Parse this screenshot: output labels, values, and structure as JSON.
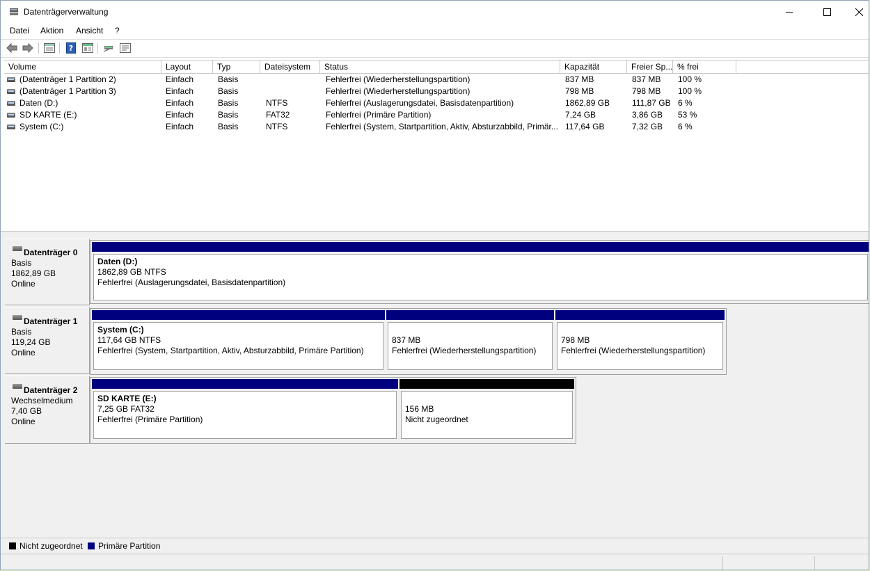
{
  "window": {
    "title": "Datenträgerverwaltung"
  },
  "menu": [
    "Datei",
    "Aktion",
    "Ansicht",
    "?"
  ],
  "toolbar": {
    "icons": [
      "back-arrow-icon",
      "forward-arrow-icon",
      "volume-view-icon",
      "help-icon",
      "properties-icon",
      "connect-disk-icon",
      "list-view-icon"
    ]
  },
  "volume_table": {
    "columns": [
      "Volume",
      "Layout",
      "Typ",
      "Dateisystem",
      "Status",
      "Kapazität",
      "Freier Sp...",
      "% frei"
    ],
    "rows": [
      [
        "(Datenträger 1 Partition 2)",
        "Einfach",
        "Basis",
        "",
        "Fehlerfrei (Wiederherstellungspartition)",
        "837 MB",
        "837 MB",
        "100 %"
      ],
      [
        "(Datenträger 1 Partition 3)",
        "Einfach",
        "Basis",
        "",
        "Fehlerfrei (Wiederherstellungspartition)",
        "798 MB",
        "798 MB",
        "100 %"
      ],
      [
        "Daten (D:)",
        "Einfach",
        "Basis",
        "NTFS",
        "Fehlerfrei (Auslagerungsdatei, Basisdatenpartition)",
        "1862,89 GB",
        "111,87 GB",
        "6 %"
      ],
      [
        "SD KARTE (E:)",
        "Einfach",
        "Basis",
        "FAT32",
        "Fehlerfrei (Primäre Partition)",
        "7,24 GB",
        "3,86 GB",
        "53 %"
      ],
      [
        "System (C:)",
        "Einfach",
        "Basis",
        "NTFS",
        "Fehlerfrei (System, Startpartition, Aktiv, Absturzabbild, Primär...",
        "117,64 GB",
        "7,32 GB",
        "6 %"
      ]
    ]
  },
  "disks": [
    {
      "name": "Datenträger 0",
      "type": "Basis",
      "size": "1862,89 GB",
      "state": "Online",
      "partitions": [
        {
          "name": "Daten  (D:)",
          "size": "1862,89 GB NTFS",
          "status": "Fehlerfrei (Auslagerungsdatei, Basisdatenpartition)",
          "kind": "primary"
        }
      ]
    },
    {
      "name": "Datenträger 1",
      "type": "Basis",
      "size": "119,24 GB",
      "state": "Online",
      "partitions": [
        {
          "name": "System  (C:)",
          "size": "117,64 GB NTFS",
          "status": "Fehlerfrei (System, Startpartition, Aktiv, Absturzabbild, Primäre Partition)",
          "kind": "primary"
        },
        {
          "name": "",
          "size": "837 MB",
          "status": "Fehlerfrei (Wiederherstellungspartition)",
          "kind": "primary"
        },
        {
          "name": "",
          "size": "798 MB",
          "status": "Fehlerfrei (Wiederherstellungspartition)",
          "kind": "primary"
        }
      ]
    },
    {
      "name": "Datenträger 2",
      "type": "Wechselmedium",
      "size": "7,40 GB",
      "state": "Online",
      "partitions": [
        {
          "name": "SD KARTE  (E:)",
          "size": "7,25 GB FAT32",
          "status": "Fehlerfrei (Primäre Partition)",
          "kind": "primary"
        },
        {
          "name": "",
          "size": "156 MB",
          "status": "Nicht zugeordnet",
          "kind": "unallocated"
        }
      ]
    }
  ],
  "legend": [
    {
      "label": "Nicht zugeordnet",
      "color": "#000000"
    },
    {
      "label": "Primäre Partition",
      "color": "#00007f"
    }
  ],
  "colors": {
    "primary": "#00007f",
    "unallocated": "#000000",
    "desktop": "#d9ecbd"
  }
}
